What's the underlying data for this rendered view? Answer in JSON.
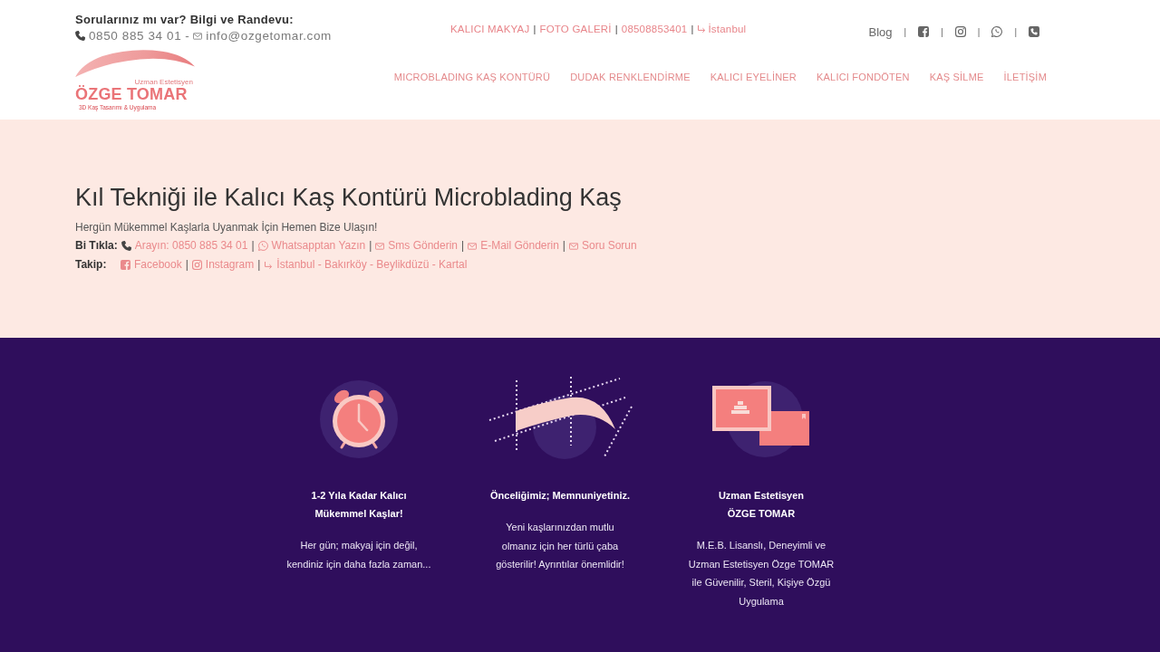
{
  "top_bar": {
    "contact_heading": "Sorularınız mı var? Bilgi ve Randevu:",
    "phone": "0850 885 34 01",
    "separator": "-",
    "email": "info@ozgetomar.com",
    "links": [
      {
        "kind": "plain",
        "label": "KALICI MAKYAJ"
      },
      {
        "kind": "plain",
        "label": "FOTO GALERİ"
      },
      {
        "kind": "plain",
        "label": "08508853401"
      },
      {
        "kind": "arrow",
        "label": "İstanbul"
      }
    ],
    "links_separator": "|",
    "blog": "Blog",
    "social_separator": "|"
  },
  "logo": {
    "subtitle": "Uzman Estetisyen",
    "name": "ÖZGE TOMAR",
    "tagline": "3D Kaş Tasarımı & Uygulama"
  },
  "nav": [
    "MICROBLADING KAŞ KONTÜRÜ",
    "DUDAK RENKLENDİRME",
    "KALICI EYELİNER",
    "KALICI FONDÖTEN",
    "KAŞ SİLME",
    "İLETİŞİM"
  ],
  "hero": {
    "title": "Kıl Tekniği ile Kalıcı Kaş Kontürü Microblading Kaş",
    "subtitle": "Hergün Mükemmel Kaşlarla Uyanmak İçin Hemen Bize Ulaşın!",
    "separator": "|",
    "rows": [
      {
        "label": "Bi Tıkla:",
        "links": [
          {
            "kind": "phone",
            "label": "Arayın: 0850 885 34 01"
          },
          {
            "kind": "whatsapp",
            "label": "Whatsapptan Yazın"
          },
          {
            "kind": "envelope",
            "label": "Sms Gönderin"
          },
          {
            "kind": "envelope",
            "label": "E-Mail Gönderin"
          },
          {
            "kind": "envelope",
            "label": "Soru Sorun"
          }
        ]
      },
      {
        "label": "Takip:",
        "links": [
          {
            "kind": "facebook",
            "label": "Facebook"
          },
          {
            "kind": "instagram",
            "label": "Instagram"
          },
          {
            "kind": "arrow",
            "label": "İstanbul - Bakırköy - Beylikdüzü - Kartal"
          }
        ]
      }
    ]
  },
  "features": [
    {
      "kind": "clock",
      "title": "1-2 Yıla Kadar Kalıcı\nMükemmel Kaşlar!",
      "text": "Her gün; makyaj için değil,\nkendiniz için daha fazla zaman..."
    },
    {
      "kind": "eyebrow",
      "title": "Önceliğimiz; Memnuniyetiniz.",
      "text": "Yeni kaşlarınızdan mutlu\nolmanız için her türlü çaba\ngösterilir! Ayrıntılar önemlidir!"
    },
    {
      "kind": "frames",
      "title": "Uzman Estetisyen\nÖZGE TOMAR",
      "text": "M.E.B. Lisanslı, Deneyimli ve\nUzman Estetisyen Özge TOMAR\nile Güvenilir, Steril, Kişiye Özgü\nUygulama"
    }
  ]
}
